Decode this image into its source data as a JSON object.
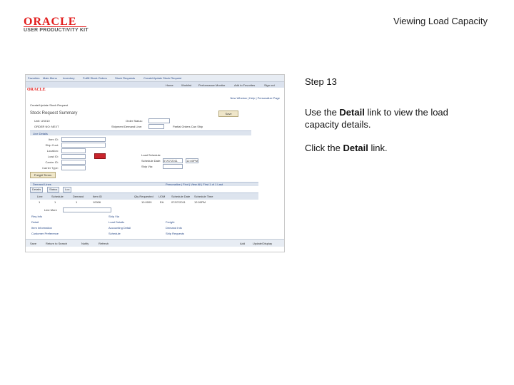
{
  "header": {
    "logo_word": "ORACLE",
    "logo_subtitle": "USER PRODUCTIVITY KIT",
    "title": "Viewing Load Capacity"
  },
  "screenshot": {
    "nav1": [
      "Favorites",
      "Main Menu",
      "Inventory",
      "Fulfill Stock Orders",
      "Stock Requests",
      "Create/Update Stock Request"
    ],
    "nav2": [
      "Home",
      "Worklist",
      "Performance Monitor",
      "Add to Favorites",
      "Sign out"
    ],
    "mini_logo": "ORACLE",
    "toolbar_right": "New Window | Help | Personalize Page",
    "breadcrumb": "Create/Update Stock Request",
    "page_heading": "Stock Request Summary",
    "top_fields": {
      "unit": "Unit: US010",
      "order_status": "Order Status:",
      "shipment_demand_line": "Shipment Demand Line:",
      "order_no": "ORDER NO: NEXT",
      "partial_orders": "Partial Orders Can Ship",
      "save_button": "Save"
    },
    "section_title": "Line Details",
    "fields": [
      {
        "label": "Item ID:"
      },
      {
        "label": "Ship Cust:"
      },
      {
        "label": "Location:"
      },
      {
        "label": "Load ID:"
      },
      {
        "label": "Carrier ID:"
      },
      {
        "label": "Carrier Type:"
      }
    ],
    "right_fields": {
      "load_schedule": "Load Schedule",
      "schedule_date": "Schedule Date:",
      "schedule_date_value": "07/07/2011",
      "schedule_time": "12:00PM",
      "ship_via": "Ship Via:"
    },
    "freight_button": "Freight Terms",
    "grid_title": "Demand Lines",
    "grid_pager": "Personalize | Find | View All | First 1 of 1 Last",
    "tabs": [
      "Details",
      "Status",
      "Loc"
    ],
    "columns": [
      "Line",
      "Schedule",
      "Demand",
      "Item ID",
      "Qty Requested",
      "UOM",
      "Schedule Date",
      "Schedule Time"
    ],
    "row": [
      "1",
      "1",
      "1",
      "10006",
      "10.0000",
      "EA",
      "07/07/2011",
      "12:00PM"
    ],
    "line_more": "Line More",
    "links": [
      "Req Info",
      "Detail",
      "Item Information",
      "Customer Preference",
      "Ship Via",
      "Load Details",
      "Accounting Detail",
      "Freight",
      "Demand Info",
      "Schedule",
      "Ship Requests"
    ],
    "bottom_buttons": [
      "Save",
      "Return to Search",
      "Notify",
      "Refresh"
    ],
    "bottom_right": [
      "Add",
      "Update/Display"
    ]
  },
  "instructions": {
    "step": "Step 13",
    "line1_prefix": "Use the ",
    "line1_bold": "Detail",
    "line1_suffix": " link to view the load capacity details.",
    "line2_prefix": "Click the ",
    "line2_bold": "Detail",
    "line2_suffix": " link."
  }
}
